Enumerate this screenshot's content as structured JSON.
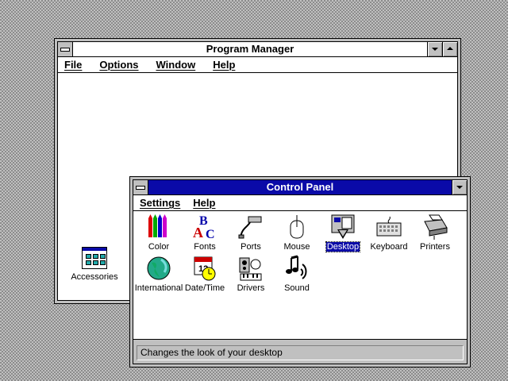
{
  "program_manager": {
    "title": "Program Manager",
    "menu": [
      "File",
      "Options",
      "Window",
      "Help"
    ],
    "groups": [
      {
        "label": "Accessories",
        "icon": "accessories-group-icon"
      }
    ]
  },
  "control_panel": {
    "title": "Control Panel",
    "menu": [
      "Settings",
      "Help"
    ],
    "items": [
      {
        "label": "Color",
        "icon": "color-icon"
      },
      {
        "label": "Fonts",
        "icon": "fonts-icon"
      },
      {
        "label": "Ports",
        "icon": "ports-icon"
      },
      {
        "label": "Mouse",
        "icon": "mouse-icon"
      },
      {
        "label": "Desktop",
        "icon": "desktop-icon",
        "selected": true
      },
      {
        "label": "Keyboard",
        "icon": "keyboard-icon"
      },
      {
        "label": "Printers",
        "icon": "printers-icon"
      },
      {
        "label": "International",
        "icon": "international-icon"
      },
      {
        "label": "Date/Time",
        "icon": "date-time-icon"
      },
      {
        "label": "Drivers",
        "icon": "drivers-icon"
      },
      {
        "label": "Sound",
        "icon": "sound-icon"
      }
    ],
    "status": "Changes the look of your desktop"
  },
  "colors": {
    "title_active": "#0a0aa8",
    "window_frame": "#c0c0c0",
    "desktop": "#c0c0c0"
  }
}
